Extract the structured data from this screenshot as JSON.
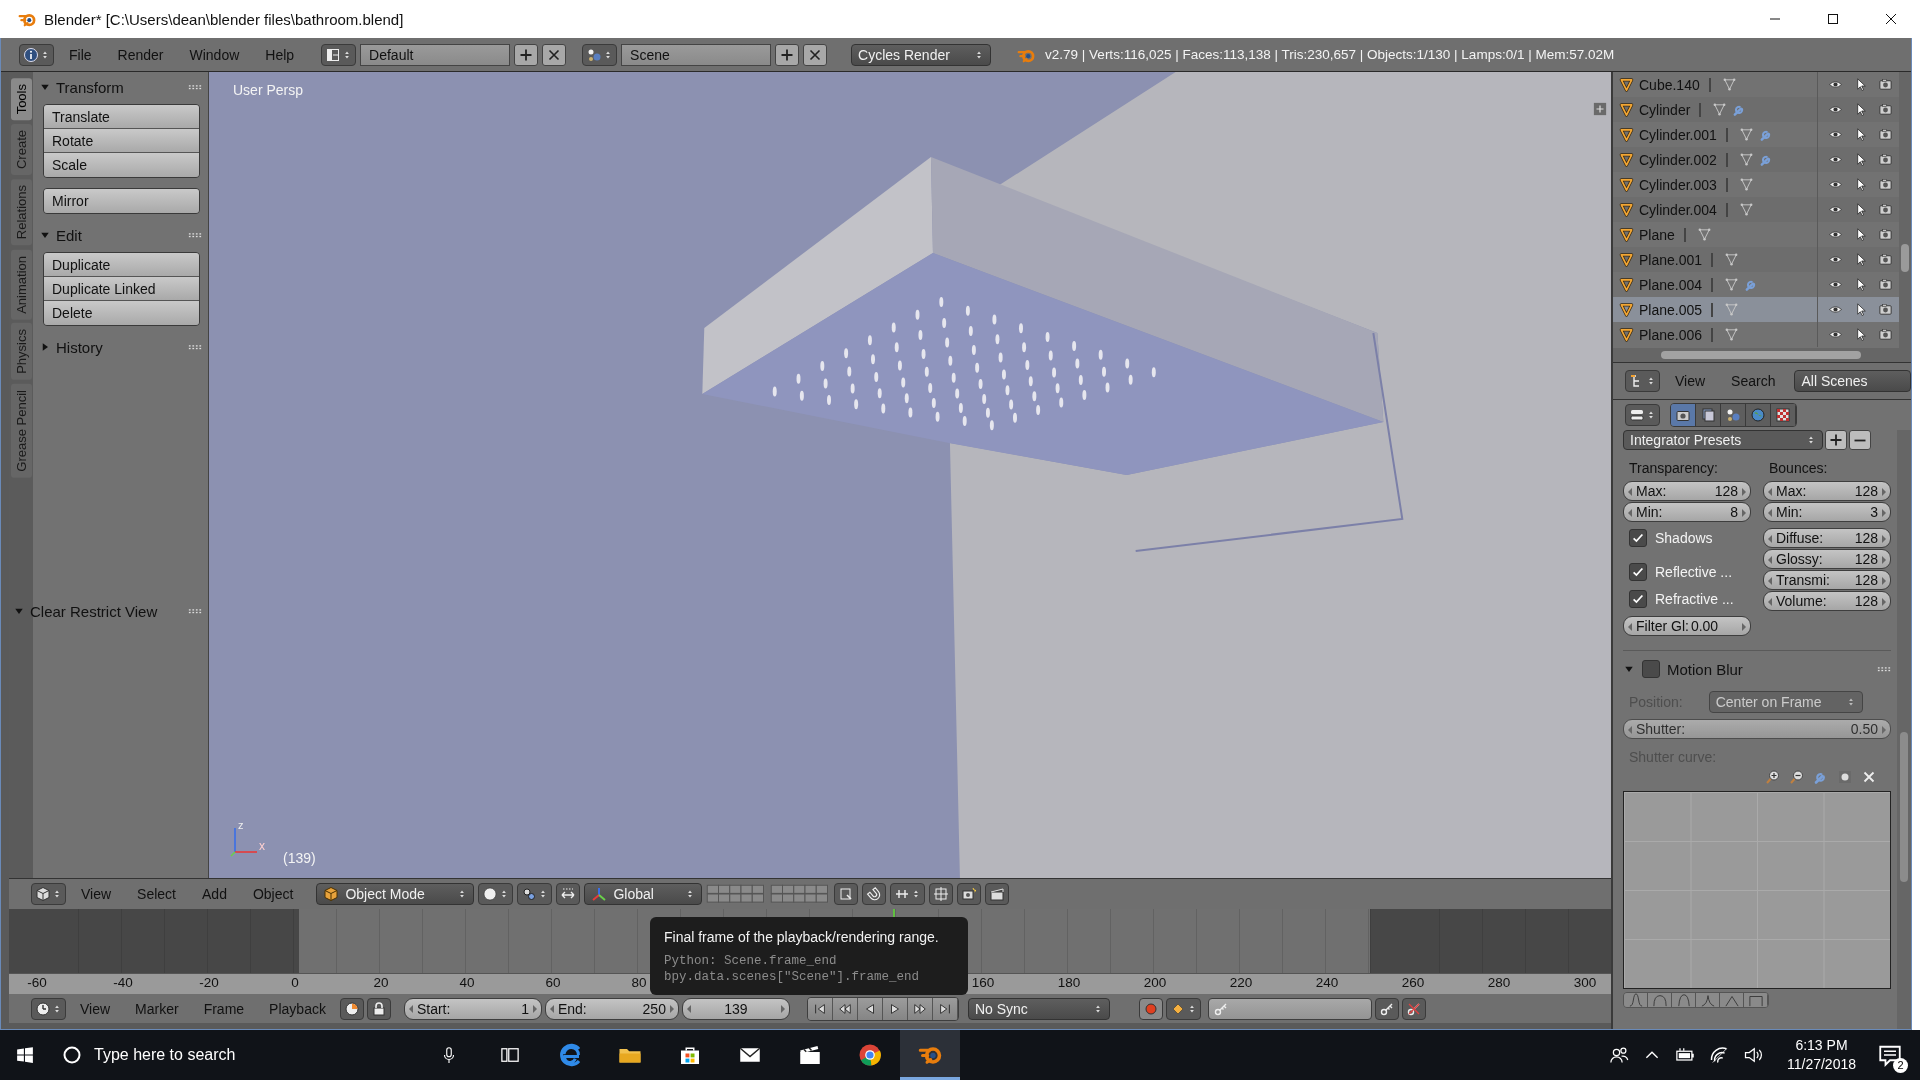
{
  "window": {
    "title": "Blender* [C:\\Users\\dean\\blender files\\bathroom.blend]"
  },
  "info_header": {
    "menus": [
      "File",
      "Render",
      "Window",
      "Help"
    ],
    "screen_layout": "Default",
    "scene": "Scene",
    "render_engine": "Cycles Render",
    "stats": "v2.79 | Verts:116,025 | Faces:113,138 | Tris:230,657 | Objects:1/130 | Lamps:0/1 | Mem:57.02M"
  },
  "tool_shelf": {
    "tabs": [
      {
        "label": "Tools",
        "selected": true
      },
      {
        "label": "Create",
        "selected": false
      },
      {
        "label": "Relations",
        "selected": false
      },
      {
        "label": "Animation",
        "selected": false
      },
      {
        "label": "Physics",
        "selected": false
      },
      {
        "label": "Grease Pencil",
        "selected": false
      }
    ],
    "panels": [
      {
        "title": "Transform",
        "expanded": true,
        "groups": [
          [
            "Translate",
            "Rotate",
            "Scale"
          ],
          [
            "Mirror"
          ]
        ]
      },
      {
        "title": "Edit",
        "expanded": true,
        "groups": [
          [
            "Duplicate",
            "Duplicate Linked",
            "Delete"
          ]
        ]
      },
      {
        "title": "History",
        "expanded": false
      }
    ],
    "operator_panel": {
      "title": "Clear Restrict View",
      "expanded": true
    }
  },
  "viewport": {
    "view_label": "User Persp",
    "frame_label": "(139)",
    "axis_labels": [
      "z",
      "x"
    ]
  },
  "viewport_header": {
    "menus": [
      "View",
      "Select",
      "Add",
      "Object"
    ],
    "mode": "Object Mode",
    "orientation": "Global"
  },
  "timeline": {
    "ruler": [
      "-60",
      "-40",
      "-20",
      "0",
      "20",
      "40",
      "60",
      "80",
      "160",
      "180",
      "200",
      "220",
      "240",
      "260",
      "280",
      "300"
    ],
    "tooltip": {
      "text": "Final frame of the playback/rendering range.",
      "python": [
        "Python: Scene.frame_end",
        "bpy.data.scenes[\"Scene\"].frame_end"
      ]
    }
  },
  "timeline_header": {
    "menus": [
      "View",
      "Marker",
      "Frame",
      "Playback"
    ],
    "start": {
      "label": "Start:",
      "value": "1"
    },
    "end": {
      "label": "End:",
      "value": "250"
    },
    "current_frame": "139",
    "sync": "No Sync"
  },
  "outliner": {
    "rows": [
      {
        "name": "Cube.140",
        "modifier": false,
        "selected": false
      },
      {
        "name": "Cylinder",
        "modifier": true,
        "selected": false
      },
      {
        "name": "Cylinder.001",
        "modifier": true,
        "selected": false
      },
      {
        "name": "Cylinder.002",
        "modifier": true,
        "selected": false
      },
      {
        "name": "Cylinder.003",
        "modifier": false,
        "selected": false
      },
      {
        "name": "Cylinder.004",
        "modifier": false,
        "selected": false
      },
      {
        "name": "Plane",
        "modifier": false,
        "selected": false
      },
      {
        "name": "Plane.001",
        "modifier": false,
        "selected": false
      },
      {
        "name": "Plane.004",
        "modifier": true,
        "selected": false
      },
      {
        "name": "Plane.005",
        "modifier": false,
        "selected": true
      },
      {
        "name": "Plane.006",
        "modifier": false,
        "selected": false
      }
    ],
    "header": {
      "menus": [
        "View",
        "Search"
      ],
      "display_mode": "All Scenes"
    }
  },
  "properties": {
    "tabs": [
      {
        "kind": "render",
        "selected": true
      },
      {
        "kind": "layers",
        "selected": false
      },
      {
        "kind": "scene",
        "selected": false
      },
      {
        "kind": "world",
        "selected": false
      },
      {
        "kind": "texture",
        "selected": false
      }
    ],
    "preset": "Integrator Presets",
    "transparency": {
      "title": "Transparency:",
      "fields": [
        {
          "label": "Max:",
          "value": "128"
        },
        {
          "label": "Min:",
          "value": "8"
        }
      ]
    },
    "bounces": {
      "title": "Bounces:",
      "fields": [
        {
          "label": "Max:",
          "value": "128"
        },
        {
          "label": "Min:",
          "value": "3"
        }
      ],
      "paths": [
        {
          "label": "Diffuse:",
          "value": "128"
        },
        {
          "label": "Glossy:",
          "value": "128"
        },
        {
          "label": "Transmi:",
          "value": "128"
        },
        {
          "label": "Volume:",
          "value": "128"
        }
      ]
    },
    "checks": [
      {
        "label": "Shadows",
        "checked": true
      },
      {
        "label": "Reflective ...",
        "checked": true
      },
      {
        "label": "Refractive ...",
        "checked": true
      }
    ],
    "filter_glossy": {
      "label": "Filter Gl:",
      "value": "0.00"
    },
    "motion_blur": {
      "title": "Motion Blur",
      "expanded": true,
      "enabled": false,
      "position_label": "Position:",
      "position": "Center on Frame",
      "shutter": {
        "label": "Shutter:",
        "value": "0.50"
      },
      "curve_label": "Shutter curve:"
    }
  },
  "taskbar": {
    "search_placeholder": "Type here to search",
    "apps": [
      {
        "kind": "edge",
        "active": false
      },
      {
        "kind": "explorer",
        "active": false
      },
      {
        "kind": "store",
        "active": false
      },
      {
        "kind": "mail",
        "active": false
      },
      {
        "kind": "movies",
        "active": false
      },
      {
        "kind": "chrome",
        "active": false
      },
      {
        "kind": "blender",
        "active": true
      }
    ],
    "time": "6:13 PM",
    "date": "11/27/2018",
    "notifications": "2"
  }
}
